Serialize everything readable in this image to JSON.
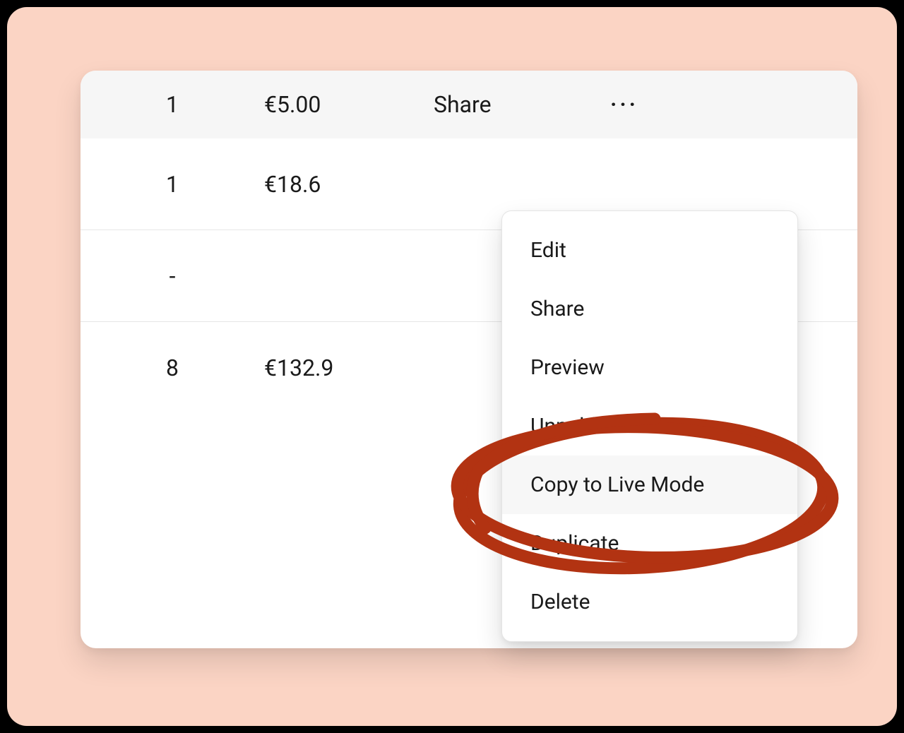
{
  "header": {
    "qty": "1",
    "price": "€5.00",
    "action": "Share",
    "more": "···"
  },
  "rows": [
    {
      "qty": "1",
      "price": "€18.6"
    },
    {
      "qty": "-",
      "price": ""
    },
    {
      "qty": "8",
      "price": "€132.9"
    }
  ],
  "menu": {
    "items": [
      "Edit",
      "Share",
      "Preview",
      "Unpublish",
      "Copy to Live Mode",
      "Duplicate",
      "Delete"
    ],
    "highlighted_index": 4
  },
  "annotation": {
    "color": "#b23312",
    "target": "Copy to Live Mode"
  }
}
